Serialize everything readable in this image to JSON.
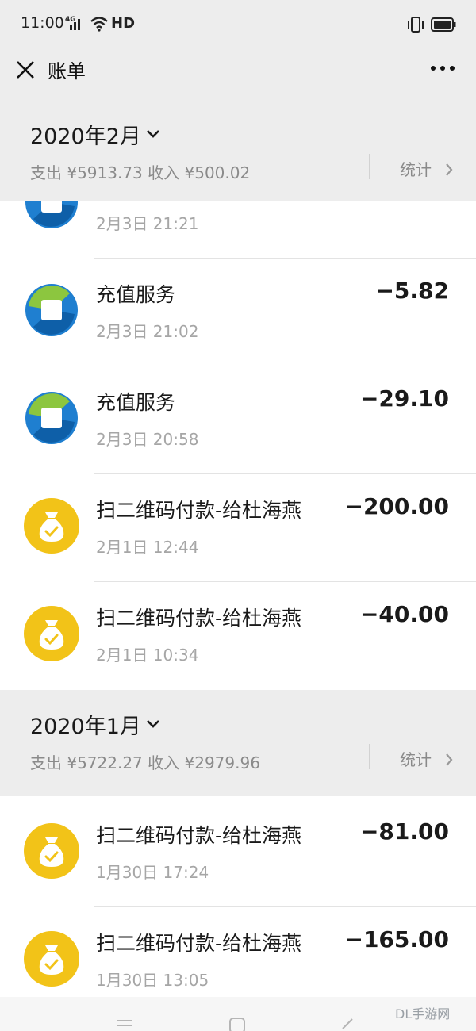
{
  "status_bar": {
    "time": "11:00",
    "network": "4G",
    "hd": "HD"
  },
  "nav": {
    "title": "账单"
  },
  "months": [
    {
      "title": "2020年2月",
      "summary": "支出 ¥5913.73 收入 ¥500.02",
      "stat_label": "统计"
    },
    {
      "title": "2020年1月",
      "summary": "支出 ¥5722.27 收入 ¥2979.96",
      "stat_label": "统计"
    }
  ],
  "transactions_feb": [
    {
      "title": "",
      "time": "2月3日 21:21",
      "amount": "",
      "icon": "recharge-service-icon"
    },
    {
      "title": "充值服务",
      "time": "2月3日 21:02",
      "amount": "−5.82",
      "icon": "recharge-service-icon"
    },
    {
      "title": "充值服务",
      "time": "2月3日 20:58",
      "amount": "−29.10",
      "icon": "recharge-service-icon"
    },
    {
      "title": "扫二维码付款-给杜海燕",
      "time": "2月1日 12:44",
      "amount": "−200.00",
      "icon": "money-bag-icon"
    },
    {
      "title": "扫二维码付款-给杜海燕",
      "time": "2月1日 10:34",
      "amount": "−40.00",
      "icon": "money-bag-icon"
    }
  ],
  "transactions_jan": [
    {
      "title": "扫二维码付款-给杜海燕",
      "time": "1月30日 17:24",
      "amount": "−81.00",
      "icon": "money-bag-icon"
    },
    {
      "title": "扫二维码付款-给杜海燕",
      "time": "1月30日 13:05",
      "amount": "−165.00",
      "icon": "money-bag-icon"
    }
  ],
  "watermark": "DL手游网",
  "colors": {
    "header_bg": "#ededed",
    "bag_yellow": "#f2c318",
    "recharge_blue": "#1f7fd0",
    "recharge_green": "#8cc63f"
  }
}
